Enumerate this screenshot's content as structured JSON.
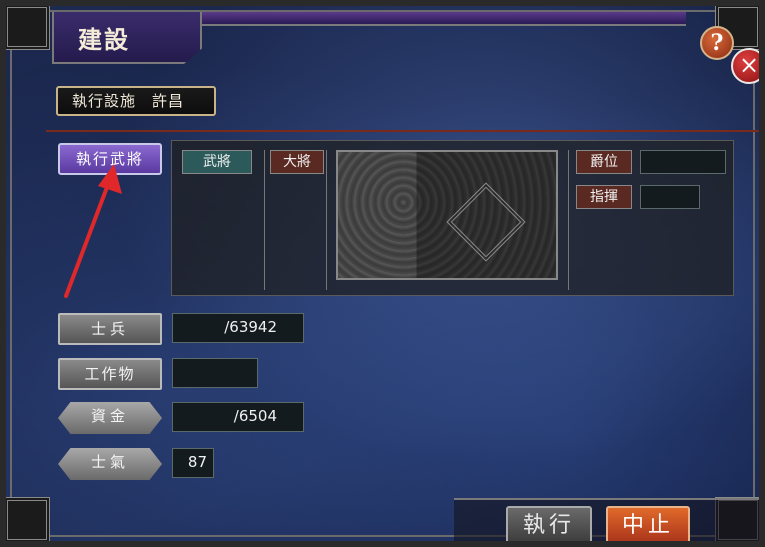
{
  "window": {
    "title": "建設",
    "help_label": "?",
    "close_label": "×"
  },
  "location": {
    "action": "執行設施",
    "city": "許昌"
  },
  "commander_button": "執行武將",
  "officer_panel": {
    "general_tab": "武將",
    "chief_tab": "大將",
    "rank_label": "爵位",
    "rank_value": "",
    "command_label": "指揮",
    "command_value": ""
  },
  "resources": {
    "soldiers_label": "士兵",
    "soldiers_value": "/63942",
    "works_label": "工作物",
    "works_value": "",
    "funds_label": "資金",
    "funds_value": "/6504",
    "morale_label": "士氣",
    "morale_value": "87"
  },
  "footer": {
    "execute_label": "執行",
    "cancel_label": "中止"
  },
  "colors": {
    "accent": "#7a5ac8",
    "cancel": "#d0502a",
    "annotation_arrow": "#e0282a"
  }
}
